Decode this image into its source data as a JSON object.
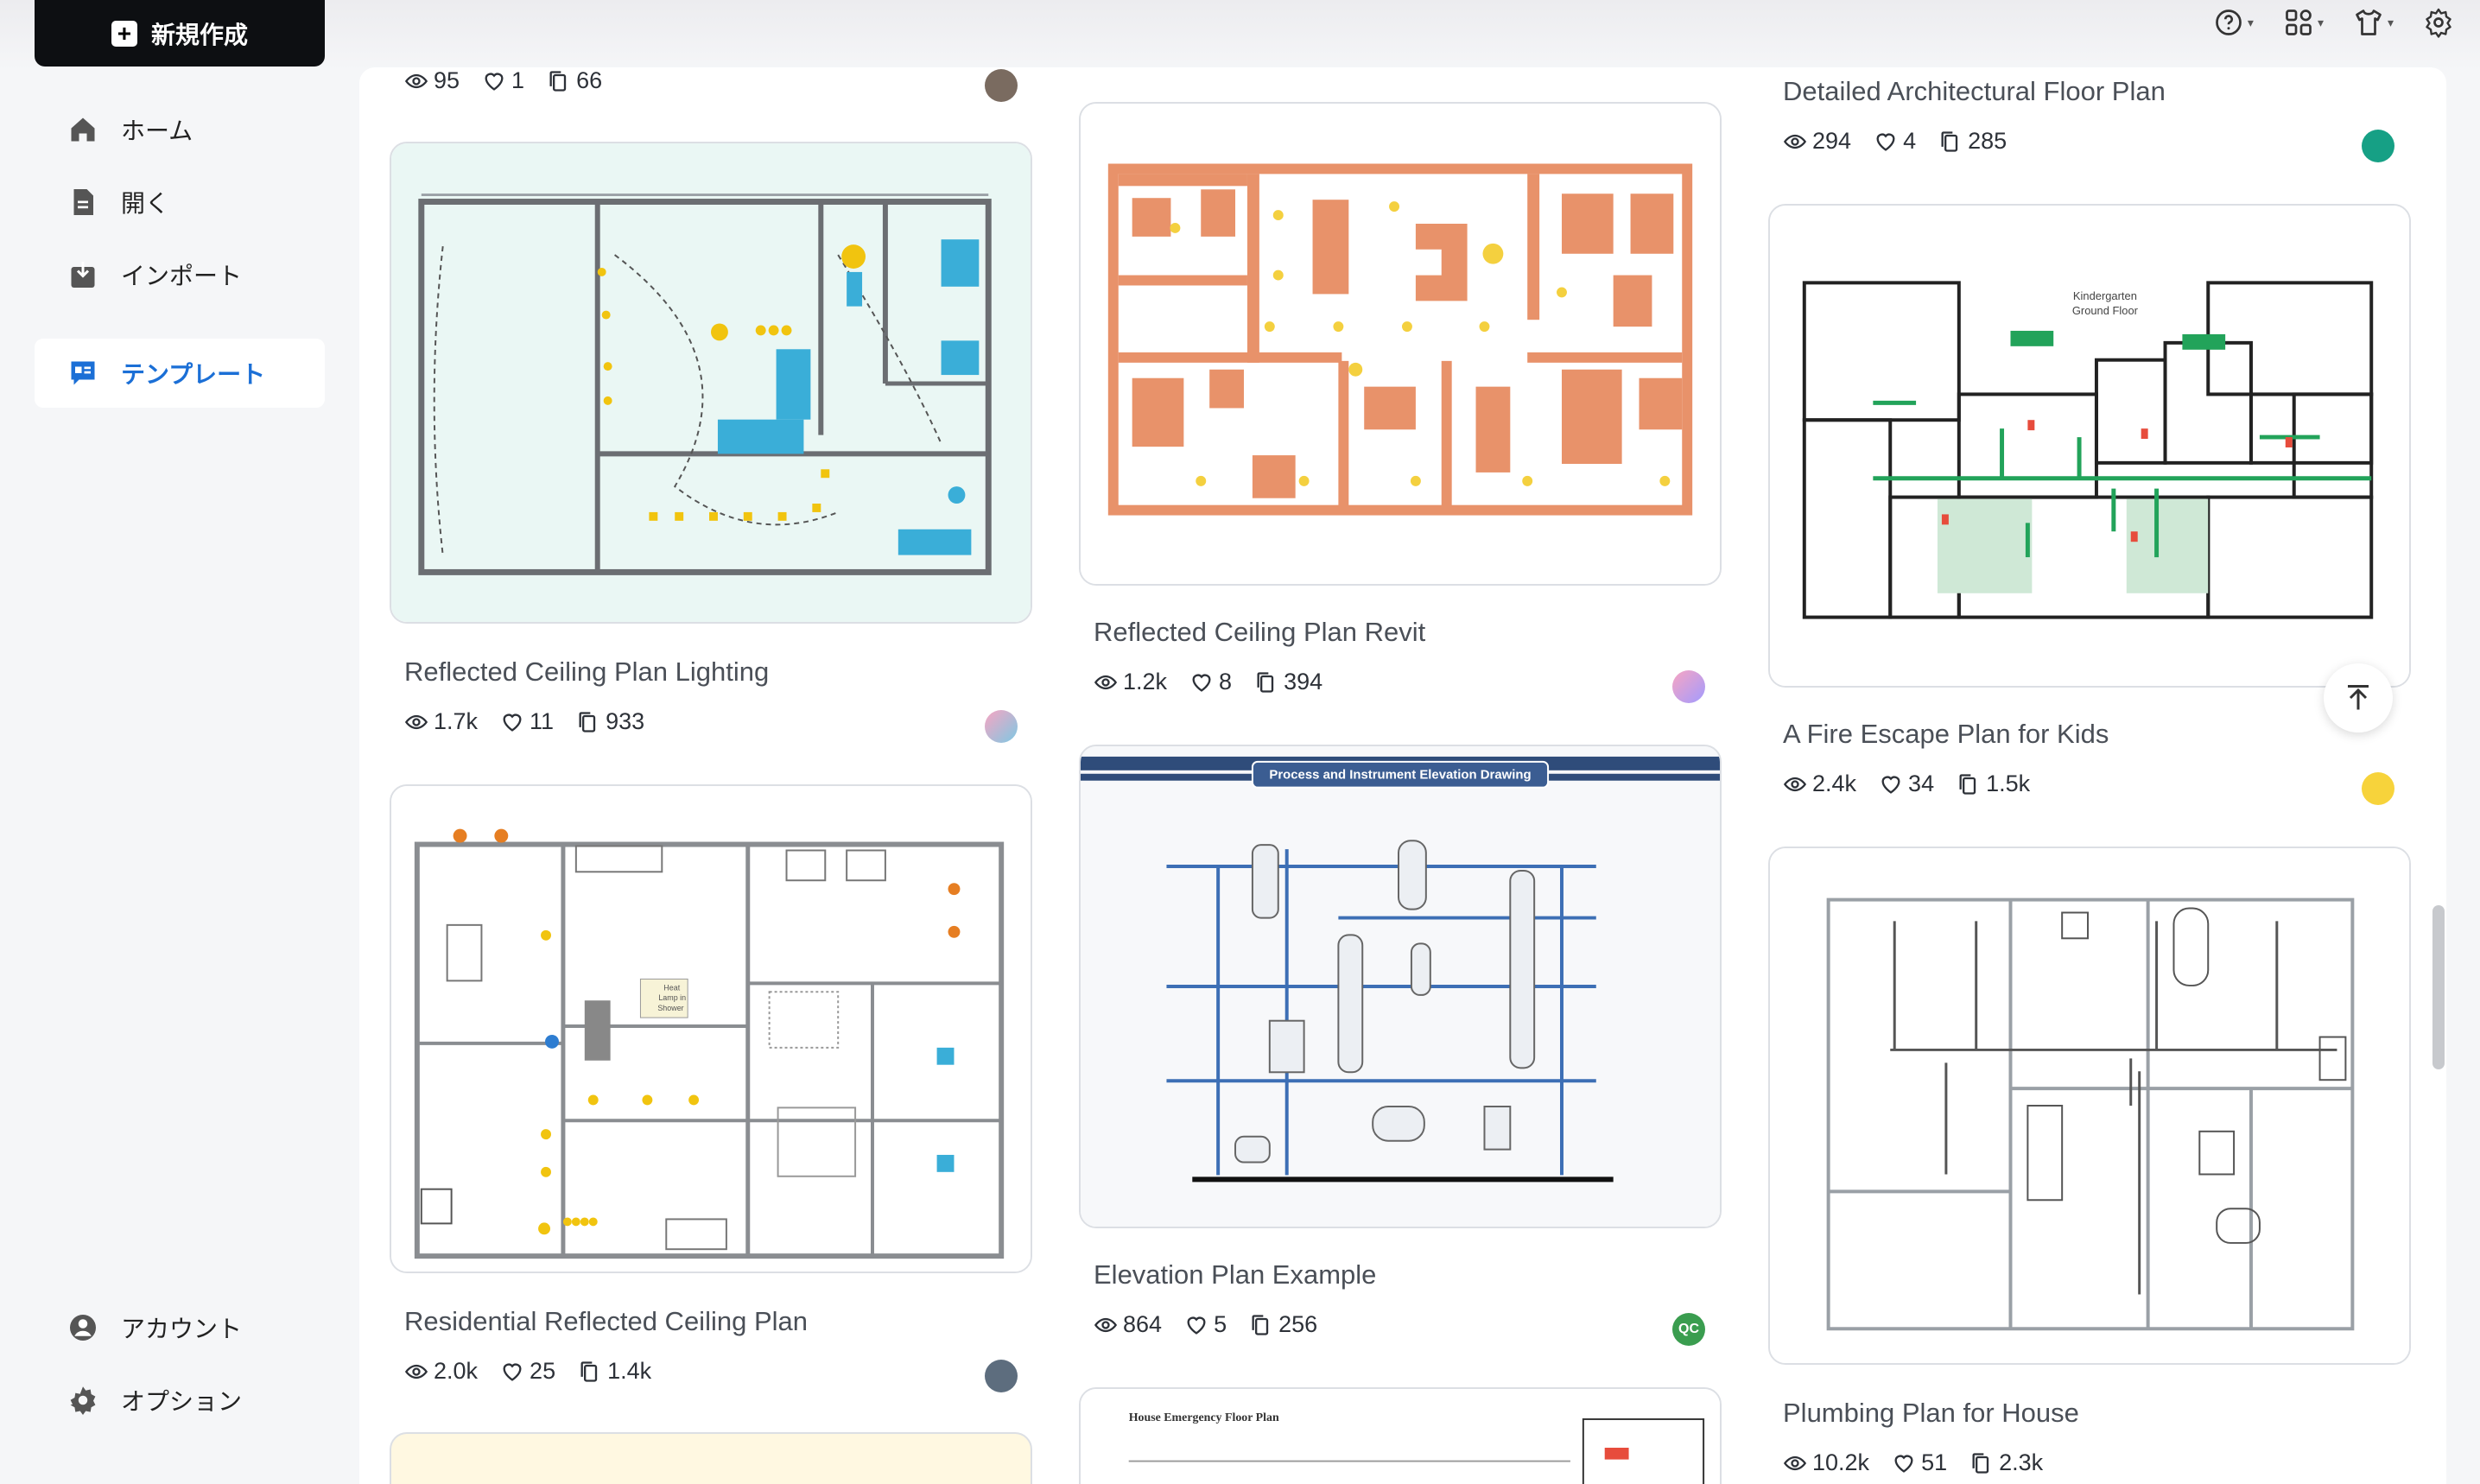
{
  "sidebar": {
    "new_button": "新規作成",
    "items": [
      {
        "label": "ホーム",
        "icon": "home-icon"
      },
      {
        "label": "開く",
        "icon": "document-icon"
      },
      {
        "label": "インポート",
        "icon": "import-icon"
      },
      {
        "label": "テンプレート",
        "icon": "template-icon",
        "active": true
      }
    ],
    "bottom_items": [
      {
        "label": "アカウント",
        "icon": "account-icon"
      },
      {
        "label": "オプション",
        "icon": "gear-icon"
      }
    ]
  },
  "topbar": {
    "icons": [
      "help-icon",
      "apps-icon",
      "shirt-icon",
      "settings-icon"
    ]
  },
  "templates": [
    {
      "title": "",
      "views": "95",
      "likes": "1",
      "copies": "66"
    },
    {
      "title": "Reflected Ceiling Plan Lighting",
      "views": "1.7k",
      "likes": "11",
      "copies": "933"
    },
    {
      "title": "Residential Reflected Ceiling Plan",
      "views": "2.0k",
      "likes": "25",
      "copies": "1.4k"
    },
    {
      "title": "Reflected Ceiling Plan Revit",
      "views": "1.2k",
      "likes": "8",
      "copies": "394"
    },
    {
      "title": "Elevation Plan Example",
      "views": "864",
      "likes": "5",
      "copies": "256",
      "author_initials": "QC"
    },
    {
      "title": "Detailed Architectural Floor Plan",
      "views": "294",
      "likes": "4",
      "copies": "285"
    },
    {
      "title": "A Fire Escape Plan for Kids",
      "views": "2.4k",
      "likes": "34",
      "copies": "1.5k"
    },
    {
      "title": "Plumbing Plan for House",
      "views": "10.2k",
      "likes": "51",
      "copies": "2.3k"
    }
  ],
  "thumbnail_text": {
    "elevation_banner": "Process and Instrument Elevation Drawing",
    "kindergarten_line1": "Kindergarten",
    "kindergarten_line2": "Ground Floor",
    "house_emergency": "House Emergency Floor Plan",
    "heat_lamp_1": "Heat",
    "heat_lamp_2": "Lamp in",
    "heat_lamp_3": "Shower"
  },
  "colors": {
    "accent": "#1b6fd6",
    "new_button_bg": "#0d0f12",
    "orange_plan": "#e8926a",
    "egress_green": "#22a35a"
  }
}
